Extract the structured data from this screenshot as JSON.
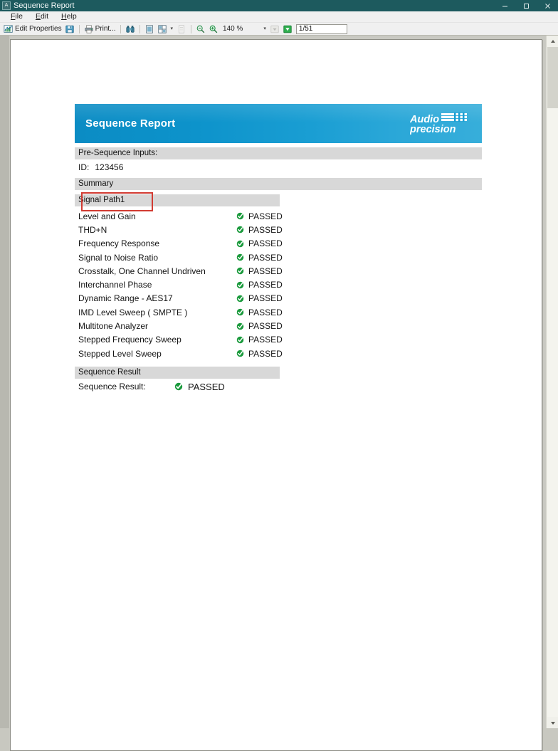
{
  "window": {
    "title": "Sequence Report",
    "app_icon": "app-icon",
    "controls": {
      "minimize": "minimize-icon",
      "maximize": "maximize-icon",
      "close": "close-icon"
    },
    "titlebar_color": "#1d5a5e"
  },
  "menu": [
    {
      "label": "File",
      "accel": "F"
    },
    {
      "label": "Edit",
      "accel": "E"
    },
    {
      "label": "Help",
      "accel": "H"
    }
  ],
  "toolbar": {
    "edit_properties_label": "Edit Properties",
    "edit_properties_icon": "chart-properties-icon",
    "save_icon": "save-disk-icon",
    "print_label": "Print...",
    "print_icon": "printer-icon",
    "find_icon": "binoculars-find-icon",
    "single_page_icon": "single-page-view-icon",
    "multi_page_icon": "multi-page-view-icon",
    "multi_page_caret": "chevron-down-icon",
    "fit_page_icon": "fit-page-icon",
    "zoom_out_icon": "zoom-out-icon",
    "zoom_in_icon": "zoom-in-icon",
    "zoom_value": "140 %",
    "zoom_caret": "chevron-down-icon",
    "prev_page_icon": "previous-page-icon",
    "next_page_icon": "next-page-icon",
    "page_value": "1/51",
    "page_placeholder": "1/51"
  },
  "scrollbar": {
    "up_icon": "scroll-up-arrow-icon",
    "down_icon": "scroll-down-arrow-icon",
    "thumb": "scroll-thumb"
  },
  "report": {
    "header": {
      "title": "Sequence Report",
      "logo_line1": "Audio",
      "logo_line2": "precision",
      "logo_name": "audio-precision-logo",
      "gradient_from": "#0b8cc4",
      "gradient_to": "#37aeda"
    },
    "sections": {
      "pre_sequence_inputs": "Pre-Sequence Inputs:",
      "summary": "Summary",
      "signal_path": "Signal Path1",
      "sequence_result_band": "Sequence Result"
    },
    "inputs": {
      "id_label": "ID:",
      "id_value": "123456",
      "highlight_color": "#d23b32"
    },
    "status_icon": "green-check-circle-icon",
    "status_color": "#1a9a3c",
    "tests": [
      {
        "name": "Level and Gain",
        "status": "PASSED"
      },
      {
        "name": "THD+N",
        "status": "PASSED"
      },
      {
        "name": "Frequency Response",
        "status": "PASSED"
      },
      {
        "name": "Signal to Noise Ratio",
        "status": "PASSED"
      },
      {
        "name": "Crosstalk, One Channel Undriven",
        "status": "PASSED"
      },
      {
        "name": "Interchannel Phase",
        "status": "PASSED"
      },
      {
        "name": "Dynamic Range - AES17",
        "status": "PASSED"
      },
      {
        "name": "IMD Level Sweep ( SMPTE )",
        "status": "PASSED"
      },
      {
        "name": "Multitone Analyzer",
        "status": "PASSED"
      },
      {
        "name": "Stepped Frequency Sweep",
        "status": "PASSED"
      },
      {
        "name": "Stepped Level Sweep",
        "status": "PASSED"
      }
    ],
    "result": {
      "label": "Sequence Result:",
      "value": "PASSED"
    }
  }
}
